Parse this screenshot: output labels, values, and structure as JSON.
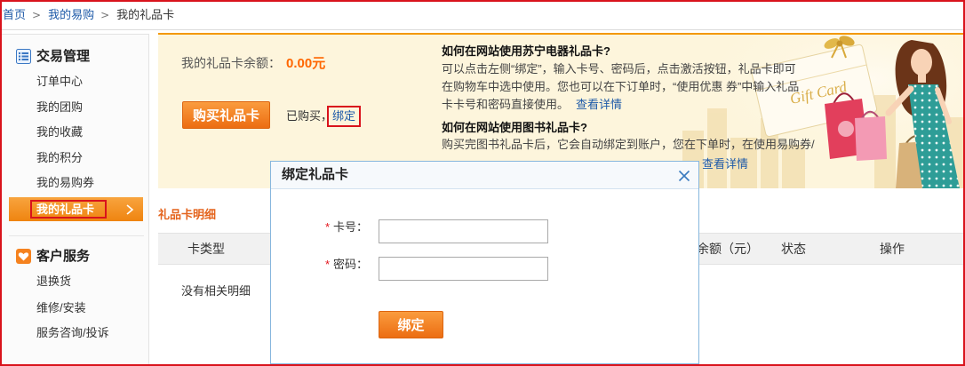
{
  "breadcrumb": {
    "items": [
      {
        "label": "首页"
      },
      {
        "label": "我的易购"
      },
      {
        "label": "我的礼品卡"
      }
    ],
    "separator": ">"
  },
  "sidebar": {
    "sections": [
      {
        "title": "交易管理",
        "icon": "list-icon",
        "items": [
          {
            "label": "订单中心"
          },
          {
            "label": "我的团购"
          },
          {
            "label": "我的收藏"
          },
          {
            "label": "我的积分"
          },
          {
            "label": "我的易购券"
          },
          {
            "label": "我的礼品卡",
            "active": true
          }
        ]
      },
      {
        "title": "客户服务",
        "icon": "heart-icon",
        "items": [
          {
            "label": "退换货"
          },
          {
            "label": "维修/安装"
          },
          {
            "label": "服务咨询/投诉"
          }
        ]
      }
    ]
  },
  "summary": {
    "balance_label": "我的礼品卡余额：",
    "balance_value": "0.00元",
    "buy_button": "购买礼品卡",
    "purchased_text": "已购买，",
    "bind_link": "绑定"
  },
  "help": [
    {
      "title": "如何在网站使用苏宁电器礼品卡?",
      "lines": [
        "可以点击左侧“绑定”，输入卡号、密码后，点击激活按钮，礼品卡即可",
        "在购物车中选中使用。您也可以在下订单时，“使用优惠 券”中输入礼品",
        "卡卡号和密码直接使用。"
      ],
      "link": "查看详情"
    },
    {
      "title": "如何在网站使用图书礼品卡?",
      "lines": [
        "购买完图书礼品卡后，它会自动绑定到账户，您在下单时，在使用易购券/"
      ],
      "link": "查看详情"
    }
  ],
  "banner": {
    "card_text": "Gift Card"
  },
  "details": {
    "title": "礼品卡明细",
    "columns": [
      "卡类型",
      "余额（元）",
      "状态",
      "操作"
    ],
    "empty_text": "没有相关明细"
  },
  "modal": {
    "title": "绑定礼品卡",
    "fields": [
      {
        "required_mark": "*",
        "label": "卡号：",
        "value": ""
      },
      {
        "required_mark": "*",
        "label": "密码：",
        "value": ""
      }
    ],
    "submit": "绑定"
  },
  "colors": {
    "accent_orange": "#f39800",
    "button_orange": "#ec6d12",
    "link_blue": "#1e5aa8",
    "highlight_red": "#d9131c",
    "banner_bg": "#fdf5dc",
    "modal_border": "#86b6dd"
  },
  "icons": {
    "trade_section": "list-icon",
    "service_section": "heart-icon",
    "active_item": "chevron-right-icon",
    "modal_close": "close-icon"
  }
}
